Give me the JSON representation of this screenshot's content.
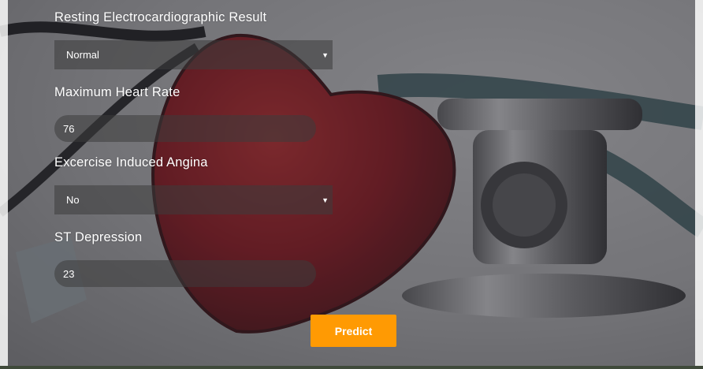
{
  "form": {
    "restecg": {
      "label": "Resting Electrocardiographic Result",
      "value": "Normal"
    },
    "max_heart_rate": {
      "label": "Maximum Heart Rate",
      "value": "76"
    },
    "exercise_angina": {
      "label": "Excercise Induced Angina",
      "value": "No"
    },
    "st_depression": {
      "label": "ST Depression",
      "value": "23"
    }
  },
  "predict_label": "Predict",
  "colors": {
    "accent": "#ff9a03",
    "heart": "#8e0b12",
    "overlay": "#28282f"
  },
  "icons": {
    "dropdown": "caret-down-icon"
  }
}
